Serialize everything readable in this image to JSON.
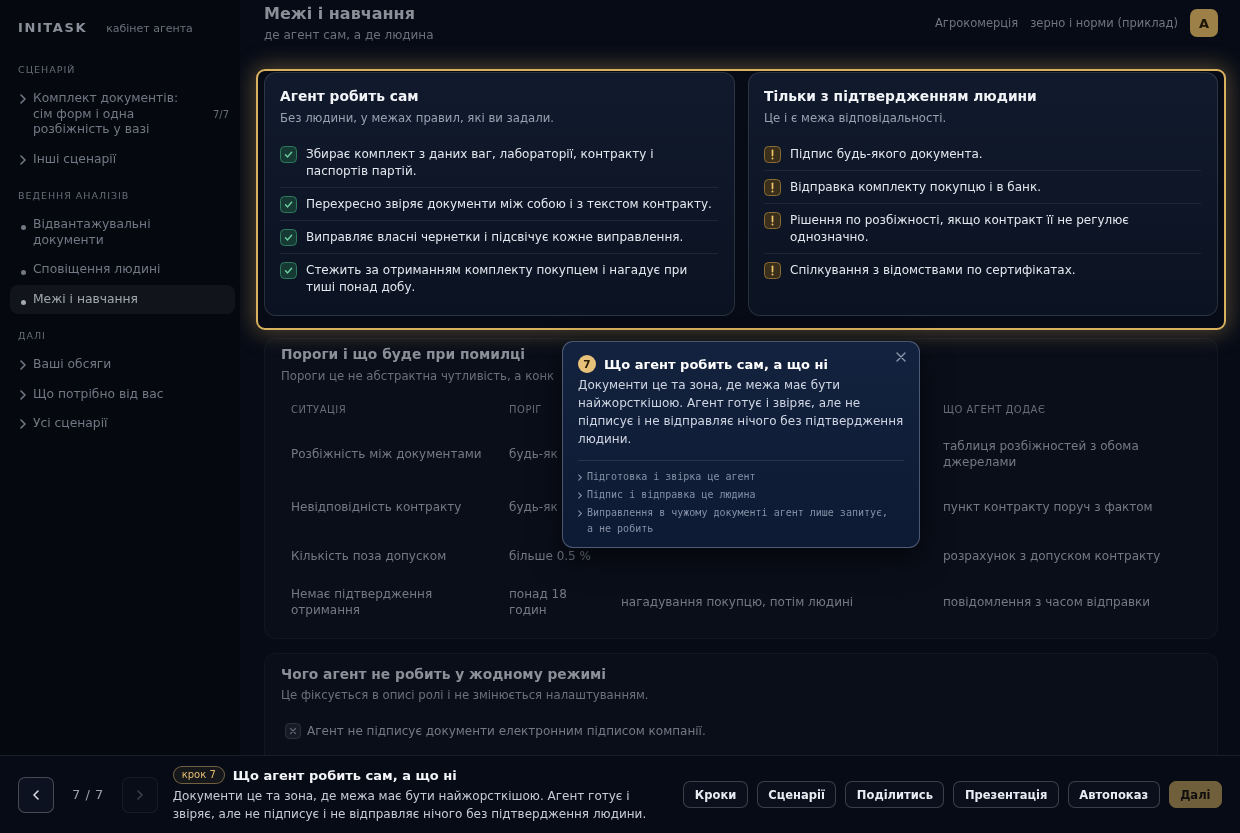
{
  "sidebar": {
    "logo": "INITASK",
    "caption": "кабінет агента",
    "sections": [
      {
        "title": "СЦЕНАРІЙ",
        "items": [
          {
            "kind": "link",
            "label": "Комплект документів: сім форм і одна розбіжність у вазі",
            "count": "7/7",
            "selected": false
          },
          {
            "kind": "link",
            "label": "Інші сценарії",
            "selected": false
          }
        ]
      },
      {
        "title": "ВЕДЕННЯ АНАЛІЗІВ",
        "items": [
          {
            "kind": "step",
            "label": "Відвантажувальні документи",
            "selected": false
          },
          {
            "kind": "step",
            "label": "Сповіщення людині",
            "selected": false
          },
          {
            "kind": "step",
            "label": "Межі і навчання",
            "selected": true
          }
        ]
      },
      {
        "title": "ДАЛІ",
        "items": [
          {
            "kind": "link",
            "label": "Ваші обсяги",
            "selected": false
          },
          {
            "kind": "link",
            "label": "Що потрібно від вас",
            "selected": false
          },
          {
            "kind": "link",
            "label": "Усі сценарії",
            "selected": false
          }
        ]
      }
    ]
  },
  "header": {
    "title": "Межі і навчання",
    "subtitle": "де агент сам, а де людина",
    "context": [
      "Агрокомерція",
      "зерно і норми (приклад)"
    ],
    "avatar": "A"
  },
  "boundaries": [
    {
      "kind": "agent",
      "title": "Агент робить сам",
      "subtitle": "Без людини, у межах правил, які ви задали.",
      "items": [
        "Збирає комплект з даних ваг, лабораторії, контракту і паспортів партій.",
        "Перехресно звіряє документи між собою і з текстом контракту.",
        "Виправляє власні чернетки і підсвічує кожне виправлення.",
        "Стежить за отриманням комплекту покупцем і нагадує при тиші понад добу."
      ]
    },
    {
      "kind": "human",
      "title": "Тільки з підтвердженням людини",
      "subtitle": "Це і є межа відповідальності.",
      "items": [
        "Підпис будь-якого документа.",
        "Відправка комплекту покупцю і в банк.",
        "Рішення по розбіжності, якщо контракт її не регулює однозначно.",
        "Спілкування з відомствами по сертифікатах."
      ]
    }
  ],
  "thresholds": {
    "title": "Пороги і що буде при помилці",
    "subtitle": "Пороги це не абстрактна чутливість, а конк",
    "columns": {
      "column_1": "СИТУАЦІЯ",
      "column_2": "ПОРІГ",
      "column_4": "ЩО АГЕНТ ДОДАЄ"
    },
    "rows": [
      {
        "column_1": "Розбіжність між документами",
        "column_2": "будь-як",
        "column_4": "таблиця розбіжностей з обома джерелами"
      },
      {
        "column_1": "Невідповідність контракту",
        "column_2": "будь-як",
        "column_4": "пункт контракту поруч з фактом"
      },
      {
        "column_1": "Кількість поза допуском",
        "column_2": "більше 0.5 %",
        "column_4": "розрахунок з допуском контракту"
      },
      {
        "column_1": "Немає підтвердження отримання",
        "column_2": "понад 18 годин",
        "column_3": "нагадування покупцю, потім людині",
        "column_4": "повідомлення з часом відправки"
      }
    ]
  },
  "never": {
    "title": "Чого агент не робить у жодному режимі",
    "subtitle": "Це фіксується в описі ролі і не змінюється налаштуванням.",
    "items": [
      "Агент не підписує документи електронним підписом компанії."
    ]
  },
  "tooltip": {
    "step": "7",
    "title": "Що агент робить сам, а що ні",
    "text": "Документи це та зона, де межа має бути найжорсткішою. Агент готує і звіряє, але не підписує і не відправляє нічого без підтвердження людини.",
    "notes": [
      "Підготовка і звірка це агент",
      "Підпис і відправка це людина",
      "Виправлення в чужому документі агент лише запитує, а не робить"
    ]
  },
  "tour_bar": {
    "prev": {
      "disabled": false
    },
    "position": "7 / 7",
    "next": {
      "disabled": true
    },
    "step_label": "крок 7",
    "title": "Що агент робить сам, а що ні",
    "text": "Документи це та зона, де межа має бути найжорсткішою. Агент готує і звіряє, але не підписує і не відправляє нічого без підтвердження людини.",
    "buttons": [
      {
        "kind": "secondary",
        "label": "Кроки",
        "disabled": false
      },
      {
        "kind": "secondary",
        "label": "Сценарії",
        "disabled": false
      },
      {
        "kind": "secondary",
        "label": "Поділитись",
        "disabled": false
      },
      {
        "kind": "secondary",
        "label": "Презентація",
        "disabled": false
      },
      {
        "kind": "secondary",
        "label": "Автопоказ",
        "disabled": false
      },
      {
        "kind": "primary",
        "label": "Далі",
        "disabled": true
      }
    ]
  }
}
